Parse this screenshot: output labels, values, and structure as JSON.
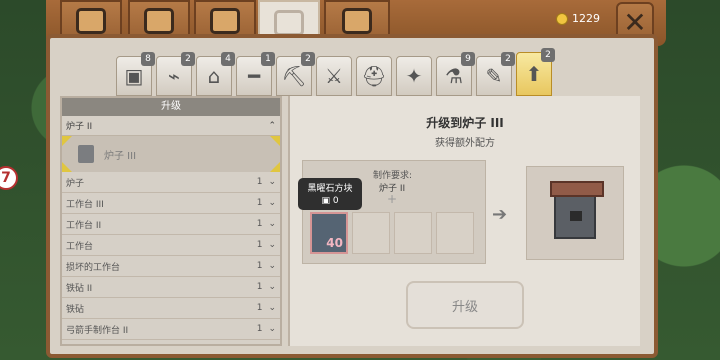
{
  "coins": "1229",
  "left_badge": "7",
  "categories": [
    {
      "badge": "8"
    },
    {
      "badge": "2"
    },
    {
      "badge": "4"
    },
    {
      "badge": "1"
    },
    {
      "badge": "2"
    },
    {},
    {},
    {},
    {
      "badge": "9"
    },
    {
      "badge": "2"
    },
    {
      "badge": "2"
    }
  ],
  "list": {
    "header": "升级",
    "group_expanded": "炉子 II",
    "selected": "炉子 III",
    "items": [
      {
        "name": "炉子",
        "count": "1"
      },
      {
        "name": "工作台 III",
        "count": "1"
      },
      {
        "name": "工作台 II",
        "count": "1"
      },
      {
        "name": "工作台",
        "count": "1"
      },
      {
        "name": "损坏的工作台",
        "count": "1"
      },
      {
        "name": "铁砧 II",
        "count": "1"
      },
      {
        "name": "铁砧",
        "count": "1"
      },
      {
        "name": "弓箭手制作台 II",
        "count": "1"
      }
    ]
  },
  "detail": {
    "title": "升级到炉子 III",
    "subtitle": "获得额外配方",
    "req_label": "制作要求:",
    "req_item": "炉子 II",
    "tooltip_name": "黑曜石方块",
    "tooltip_count": "0",
    "count": "40",
    "button": "升级"
  }
}
